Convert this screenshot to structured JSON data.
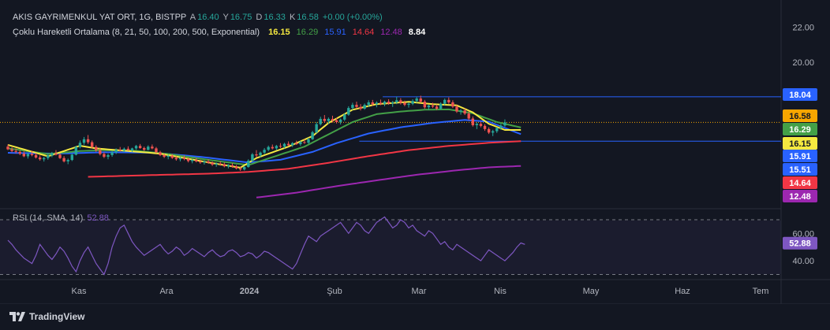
{
  "header": {
    "symbol": "AKIS GAYRIMENKUL YAT ORT, 1G, BISTPP",
    "o_label": "A",
    "o_value": "16.40",
    "h_label": "Y",
    "h_value": "16.75",
    "l_label": "D",
    "l_value": "16.33",
    "c_label": "K",
    "c_value": "16.58",
    "change": "+0.00 (+0.00%)",
    "ma_label": "Çoklu Hareketli Ortalama (8, 21, 50, 100, 200, 500, Exponential)",
    "ma_values": [
      {
        "value": "16.15",
        "color": "#f5e940"
      },
      {
        "value": "16.29",
        "color": "#43a047"
      },
      {
        "value": "15.91",
        "color": "#2962ff"
      },
      {
        "value": "14.64",
        "color": "#f23645"
      },
      {
        "value": "12.48",
        "color": "#9c27b0"
      },
      {
        "value": "8.84",
        "color": "#ffffff"
      }
    ],
    "rsi_label": "RSI (14, SMA, 14)",
    "rsi_value": "52.88"
  },
  "branding": {
    "name": "TradingView"
  },
  "chart_data": {
    "type": "candlestick",
    "price_axis": {
      "ticks": [
        "22.00",
        "20.00"
      ],
      "ylim": [
        11.8,
        23.1
      ]
    },
    "time_axis": {
      "labels": [
        "Kas",
        "Ara",
        "2024",
        "Şub",
        "Mar",
        "Nis",
        "May",
        "Haz",
        "Tem"
      ]
    },
    "price_labels": [
      {
        "text": "18.04",
        "bg": "#2962ff",
        "fg": "#ffffff",
        "price": 18.04
      },
      {
        "text": "16.58",
        "bg": "#f7a600",
        "fg": "#131722",
        "price": 16.58
      },
      {
        "text": "16.29",
        "bg": "#43a047",
        "fg": "#ffffff",
        "price": 16.29
      },
      {
        "text": "16.15",
        "bg": "#f5e940",
        "fg": "#131722",
        "price": 16.15
      },
      {
        "text": "15.91",
        "bg": "#2962ff",
        "fg": "#ffffff",
        "price": 15.91
      },
      {
        "text": "15.51",
        "bg": "#2962ff",
        "fg": "#ffffff",
        "price": 15.51
      },
      {
        "text": "14.64",
        "bg": "#f23645",
        "fg": "#ffffff",
        "price": 14.64
      },
      {
        "text": "12.48",
        "bg": "#9c27b0",
        "fg": "#ffffff",
        "price": 12.48
      }
    ],
    "horizontal_lines": [
      {
        "price": 18.04,
        "color": "#2962ff",
        "style": "solid",
        "from_x": 0.49
      },
      {
        "price": 16.58,
        "color": "#f7a600",
        "style": "dotted",
        "from_x": 0.0
      },
      {
        "price": 15.51,
        "color": "#2962ff",
        "style": "solid",
        "from_x": 0.46
      }
    ],
    "colors": {
      "up": "#26a69a",
      "down": "#ef5350"
    },
    "moving_averages": [
      {
        "name": "EMA 8",
        "color": "#f5e940"
      },
      {
        "name": "EMA 21",
        "color": "#43a047"
      },
      {
        "name": "EMA 50",
        "color": "#2962ff"
      },
      {
        "name": "EMA 100",
        "color": "#f23645"
      },
      {
        "name": "EMA 200",
        "color": "#9c27b0"
      }
    ],
    "rsi": {
      "ticks": [
        "60.00",
        "40.00"
      ],
      "bands": [
        70,
        30
      ],
      "value_label": "52.88",
      "color": "#7e57c2",
      "ylim": [
        28,
        74
      ],
      "values": [
        55,
        52,
        48,
        45,
        42,
        40,
        38,
        44,
        52,
        48,
        44,
        41,
        45,
        50,
        47,
        42,
        36,
        32,
        40,
        46,
        50,
        44,
        38,
        34,
        30,
        38,
        50,
        58,
        64,
        66,
        60,
        54,
        50,
        47,
        44,
        46,
        48,
        50,
        52,
        48,
        45,
        47,
        50,
        48,
        44,
        46,
        49,
        47,
        45,
        43,
        46,
        48,
        45,
        43,
        44,
        47,
        48,
        46,
        43,
        44,
        46,
        45,
        42,
        44,
        47,
        46,
        44,
        42,
        40,
        38,
        36,
        34,
        38,
        45,
        52,
        58,
        56,
        54,
        58,
        60,
        62,
        64,
        66,
        68,
        64,
        60,
        64,
        68,
        66,
        62,
        60,
        64,
        68,
        70,
        72,
        68,
        64,
        66,
        70,
        68,
        64,
        66,
        62,
        60,
        58,
        62,
        60,
        56,
        52,
        54,
        50,
        48,
        52,
        50,
        48,
        46,
        44,
        42,
        40,
        44,
        48,
        46,
        44,
        42,
        40,
        43,
        46,
        50,
        53,
        52
      ]
    },
    "ohlc": [
      [
        15.2,
        15.32,
        15.0,
        15.05
      ],
      [
        15.05,
        15.16,
        14.88,
        14.95
      ],
      [
        14.95,
        15.1,
        14.82,
        14.9
      ],
      [
        14.9,
        15.0,
        14.72,
        14.8
      ],
      [
        14.8,
        14.95,
        14.6,
        14.65
      ],
      [
        14.65,
        14.85,
        14.52,
        14.78
      ],
      [
        14.78,
        14.96,
        14.65,
        14.72
      ],
      [
        14.72,
        14.84,
        14.52,
        14.58
      ],
      [
        14.58,
        14.7,
        14.4,
        14.48
      ],
      [
        14.48,
        14.62,
        14.35,
        14.55
      ],
      [
        14.55,
        14.78,
        14.45,
        14.7
      ],
      [
        14.7,
        14.9,
        14.6,
        14.82
      ],
      [
        14.82,
        15.0,
        14.7,
        14.74
      ],
      [
        14.74,
        14.82,
        14.5,
        14.55
      ],
      [
        14.55,
        14.66,
        14.3,
        14.36
      ],
      [
        14.36,
        14.52,
        14.2,
        14.44
      ],
      [
        14.44,
        14.8,
        14.38,
        14.74
      ],
      [
        14.74,
        15.25,
        14.7,
        15.18
      ],
      [
        15.18,
        15.55,
        15.1,
        15.42
      ],
      [
        15.42,
        15.75,
        15.3,
        15.62
      ],
      [
        15.62,
        15.86,
        15.35,
        15.45
      ],
      [
        15.45,
        15.55,
        15.1,
        15.18
      ],
      [
        15.18,
        15.28,
        14.9,
        15.0
      ],
      [
        15.0,
        15.12,
        14.7,
        14.78
      ],
      [
        14.78,
        14.88,
        14.55,
        14.62
      ],
      [
        14.62,
        14.8,
        14.48,
        14.72
      ],
      [
        14.72,
        14.96,
        14.62,
        14.88
      ],
      [
        14.88,
        15.1,
        14.78,
        15.02
      ],
      [
        15.02,
        15.18,
        14.92,
        14.98
      ],
      [
        14.98,
        15.15,
        14.88,
        15.08
      ],
      [
        15.08,
        15.22,
        14.96,
        15.0
      ],
      [
        15.0,
        15.14,
        14.9,
        15.1
      ],
      [
        15.1,
        15.3,
        15.02,
        15.24
      ],
      [
        15.24,
        15.35,
        15.08,
        15.12
      ],
      [
        15.12,
        15.2,
        14.96,
        15.02
      ],
      [
        15.02,
        15.28,
        14.98,
        15.2
      ],
      [
        15.2,
        15.32,
        15.05,
        15.1
      ],
      [
        15.1,
        15.18,
        14.82,
        14.88
      ],
      [
        14.88,
        14.96,
        14.66,
        14.72
      ],
      [
        14.72,
        14.82,
        14.55,
        14.62
      ],
      [
        14.62,
        14.75,
        14.48,
        14.68
      ],
      [
        14.68,
        14.78,
        14.5,
        14.56
      ],
      [
        14.56,
        14.66,
        14.4,
        14.48
      ],
      [
        14.48,
        14.62,
        14.36,
        14.56
      ],
      [
        14.56,
        14.7,
        14.42,
        14.5
      ],
      [
        14.5,
        14.58,
        14.3,
        14.38
      ],
      [
        14.38,
        14.5,
        14.25,
        14.44
      ],
      [
        14.44,
        14.56,
        14.3,
        14.36
      ],
      [
        14.36,
        14.46,
        14.22,
        14.3
      ],
      [
        14.3,
        14.42,
        14.18,
        14.36
      ],
      [
        14.36,
        14.48,
        14.22,
        14.28
      ],
      [
        14.28,
        14.36,
        14.1,
        14.18
      ],
      [
        14.18,
        14.3,
        14.05,
        14.24
      ],
      [
        14.24,
        14.36,
        14.12,
        14.2
      ],
      [
        14.2,
        14.3,
        14.02,
        14.08
      ],
      [
        14.08,
        14.2,
        13.96,
        14.14
      ],
      [
        14.14,
        14.26,
        14.0,
        14.06
      ],
      [
        14.06,
        14.16,
        13.9,
        13.96
      ],
      [
        13.96,
        14.06,
        13.82,
        13.9
      ],
      [
        13.9,
        14.1,
        13.84,
        14.04
      ],
      [
        14.04,
        14.48,
        14.0,
        14.4
      ],
      [
        14.4,
        14.84,
        14.34,
        14.76
      ],
      [
        14.76,
        15.0,
        14.6,
        14.7
      ],
      [
        14.7,
        14.92,
        14.58,
        14.86
      ],
      [
        14.86,
        15.12,
        14.78,
        15.02
      ],
      [
        15.02,
        15.26,
        14.94,
        15.18
      ],
      [
        15.18,
        15.32,
        15.04,
        15.1
      ],
      [
        15.1,
        15.3,
        15.0,
        15.24
      ],
      [
        15.24,
        15.4,
        15.12,
        15.2
      ],
      [
        15.2,
        15.42,
        15.1,
        15.36
      ],
      [
        15.36,
        15.5,
        15.22,
        15.28
      ],
      [
        15.28,
        15.46,
        15.18,
        15.4
      ],
      [
        15.4,
        15.54,
        15.3,
        15.34
      ],
      [
        15.34,
        15.52,
        15.24,
        15.46
      ],
      [
        15.46,
        15.62,
        15.36,
        15.42
      ],
      [
        15.42,
        15.7,
        15.36,
        15.62
      ],
      [
        15.62,
        16.1,
        15.58,
        16.02
      ],
      [
        16.02,
        16.6,
        15.96,
        16.48
      ],
      [
        16.48,
        16.9,
        16.4,
        16.78
      ],
      [
        16.78,
        17.0,
        16.56,
        16.66
      ],
      [
        16.66,
        16.86,
        16.5,
        16.78
      ],
      [
        16.78,
        16.96,
        16.58,
        16.7
      ],
      [
        16.7,
        16.84,
        16.52,
        16.6
      ],
      [
        16.6,
        16.8,
        16.46,
        16.74
      ],
      [
        16.74,
        17.1,
        16.66,
        17.02
      ],
      [
        17.02,
        17.5,
        16.96,
        17.4
      ],
      [
        17.4,
        17.7,
        17.28,
        17.58
      ],
      [
        17.58,
        17.76,
        17.36,
        17.46
      ],
      [
        17.46,
        17.62,
        17.26,
        17.36
      ],
      [
        17.36,
        17.66,
        17.3,
        17.58
      ],
      [
        17.58,
        17.84,
        17.46,
        17.72
      ],
      [
        17.72,
        17.86,
        17.52,
        17.62
      ],
      [
        17.62,
        17.78,
        17.44,
        17.7
      ],
      [
        17.7,
        17.88,
        17.56,
        17.64
      ],
      [
        17.64,
        17.82,
        17.5,
        17.76
      ],
      [
        17.76,
        17.9,
        17.58,
        17.66
      ],
      [
        17.66,
        17.8,
        17.46,
        17.72
      ],
      [
        17.72,
        18.04,
        17.62,
        17.84
      ],
      [
        17.84,
        17.96,
        17.6,
        17.7
      ],
      [
        17.7,
        17.82,
        17.5,
        17.58
      ],
      [
        17.58,
        17.72,
        17.42,
        17.64
      ],
      [
        17.64,
        17.9,
        17.56,
        17.8
      ],
      [
        17.8,
        18.04,
        17.7,
        17.94
      ],
      [
        17.94,
        18.1,
        17.7,
        17.76
      ],
      [
        17.76,
        17.86,
        17.36,
        17.44
      ],
      [
        17.44,
        17.6,
        17.3,
        17.54
      ],
      [
        17.54,
        17.7,
        17.4,
        17.48
      ],
      [
        17.48,
        17.6,
        17.28,
        17.36
      ],
      [
        17.36,
        17.72,
        17.3,
        17.64
      ],
      [
        17.64,
        17.94,
        17.56,
        17.86
      ],
      [
        17.86,
        18.0,
        17.64,
        17.72
      ],
      [
        17.72,
        17.84,
        17.4,
        17.48
      ],
      [
        17.48,
        17.58,
        17.12,
        17.2
      ],
      [
        17.2,
        17.34,
        17.02,
        17.26
      ],
      [
        17.26,
        17.38,
        17.0,
        17.08
      ],
      [
        17.08,
        17.2,
        16.7,
        16.8
      ],
      [
        16.8,
        16.92,
        16.34,
        16.42
      ],
      [
        16.42,
        16.58,
        16.2,
        16.5
      ],
      [
        16.5,
        16.62,
        16.3,
        16.38
      ],
      [
        16.38,
        16.48,
        16.1,
        16.2
      ],
      [
        16.2,
        16.3,
        15.92,
        16.0
      ],
      [
        16.0,
        16.16,
        15.8,
        16.08
      ],
      [
        16.08,
        16.32,
        15.98,
        16.26
      ],
      [
        16.26,
        16.5,
        16.16,
        16.4
      ],
      [
        16.4,
        16.75,
        16.33,
        16.58
      ]
    ],
    "ema": {
      "ema8": {
        "start": 0,
        "points": [
          [
            0,
            15.3
          ],
          [
            10,
            14.65
          ],
          [
            18,
            15.25
          ],
          [
            22,
            15.1
          ],
          [
            30,
            14.95
          ],
          [
            38,
            14.8
          ],
          [
            50,
            14.3
          ],
          [
            58,
            14.0
          ],
          [
            62,
            14.55
          ],
          [
            70,
            15.2
          ],
          [
            76,
            15.8
          ],
          [
            80,
            16.55
          ],
          [
            86,
            17.3
          ],
          [
            92,
            17.62
          ],
          [
            100,
            17.75
          ],
          [
            106,
            17.62
          ],
          [
            112,
            17.55
          ],
          [
            116,
            17.15
          ],
          [
            120,
            16.5
          ],
          [
            124,
            16.15
          ],
          [
            128,
            16.15
          ]
        ]
      },
      "ema21": {
        "start": 0,
        "points": [
          [
            0,
            15.1
          ],
          [
            10,
            14.78
          ],
          [
            18,
            14.95
          ],
          [
            24,
            15.0
          ],
          [
            32,
            14.96
          ],
          [
            40,
            14.78
          ],
          [
            50,
            14.45
          ],
          [
            60,
            14.15
          ],
          [
            66,
            14.6
          ],
          [
            74,
            15.2
          ],
          [
            80,
            15.9
          ],
          [
            86,
            16.6
          ],
          [
            92,
            17.05
          ],
          [
            98,
            17.2
          ],
          [
            104,
            17.3
          ],
          [
            110,
            17.32
          ],
          [
            116,
            17.1
          ],
          [
            122,
            16.6
          ],
          [
            128,
            16.29
          ]
        ]
      },
      "ema50": {
        "start": 0,
        "points": [
          [
            0,
            14.85
          ],
          [
            12,
            14.8
          ],
          [
            24,
            14.88
          ],
          [
            36,
            14.86
          ],
          [
            48,
            14.62
          ],
          [
            60,
            14.3
          ],
          [
            68,
            14.45
          ],
          [
            76,
            14.9
          ],
          [
            82,
            15.4
          ],
          [
            90,
            15.95
          ],
          [
            98,
            16.3
          ],
          [
            106,
            16.55
          ],
          [
            114,
            16.72
          ],
          [
            120,
            16.62
          ],
          [
            128,
            15.91
          ]
        ]
      },
      "ema100": {
        "start": 20,
        "points": [
          [
            20,
            13.48
          ],
          [
            36,
            13.58
          ],
          [
            50,
            13.66
          ],
          [
            60,
            13.76
          ],
          [
            70,
            13.94
          ],
          [
            80,
            14.28
          ],
          [
            90,
            14.66
          ],
          [
            100,
            15.0
          ],
          [
            110,
            15.24
          ],
          [
            120,
            15.42
          ],
          [
            128,
            15.51
          ]
        ]
      },
      "ema200": {
        "start": 62,
        "points": [
          [
            62,
            12.3
          ],
          [
            72,
            12.58
          ],
          [
            82,
            12.95
          ],
          [
            92,
            13.28
          ],
          [
            102,
            13.6
          ],
          [
            112,
            13.85
          ],
          [
            120,
            14.02
          ],
          [
            128,
            14.1
          ]
        ]
      }
    }
  }
}
